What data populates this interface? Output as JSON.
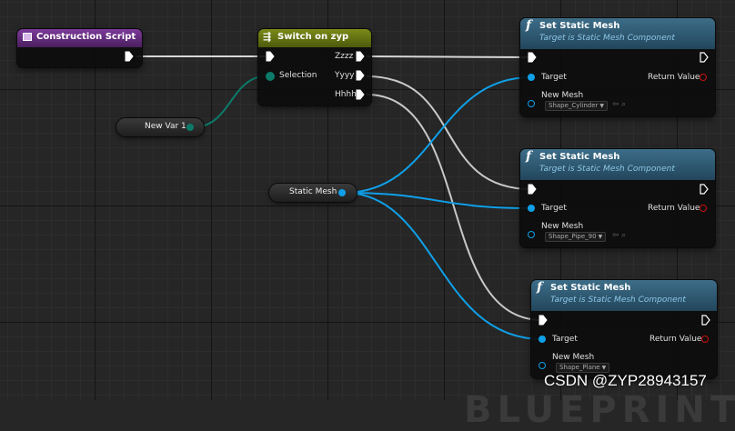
{
  "construction_script": {
    "title": "Construction Script"
  },
  "switch_node": {
    "title": "Switch on zyp",
    "selection_label": "Selection",
    "outputs": [
      "Zzzz",
      "Yyyy",
      "Hhhh"
    ]
  },
  "var_node": {
    "label": "New Var 1"
  },
  "static_mesh_var": {
    "label": "Static Mesh"
  },
  "set_static_mesh_nodes": [
    {
      "title": "Set Static Mesh",
      "subtitle": "Target is Static Mesh Component",
      "target_label": "Target",
      "return_label": "Return Value",
      "new_mesh_label": "New Mesh",
      "mesh_value": "Shape_Cylinder"
    },
    {
      "title": "Set Static Mesh",
      "subtitle": "Target is Static Mesh Component",
      "target_label": "Target",
      "return_label": "Return Value",
      "new_mesh_label": "New Mesh",
      "mesh_value": "Shape_Pipe_90"
    },
    {
      "title": "Set Static Mesh",
      "subtitle": "Target is Static Mesh Component",
      "target_label": "Target",
      "return_label": "Return Value",
      "new_mesh_label": "New Mesh",
      "mesh_value": "Shape_Plane"
    }
  ],
  "colors": {
    "exec": "#ffffff",
    "object": "#0fa0e8",
    "enum": "#0d7a6a",
    "construction_header": "#6b2c86",
    "switch_header": "#5f6a12",
    "function_header": "#2f5a74",
    "return_pin": "#cc1111"
  },
  "watermark": "CSDN @ZYP28943157",
  "background_text": "BLUEPRINT"
}
